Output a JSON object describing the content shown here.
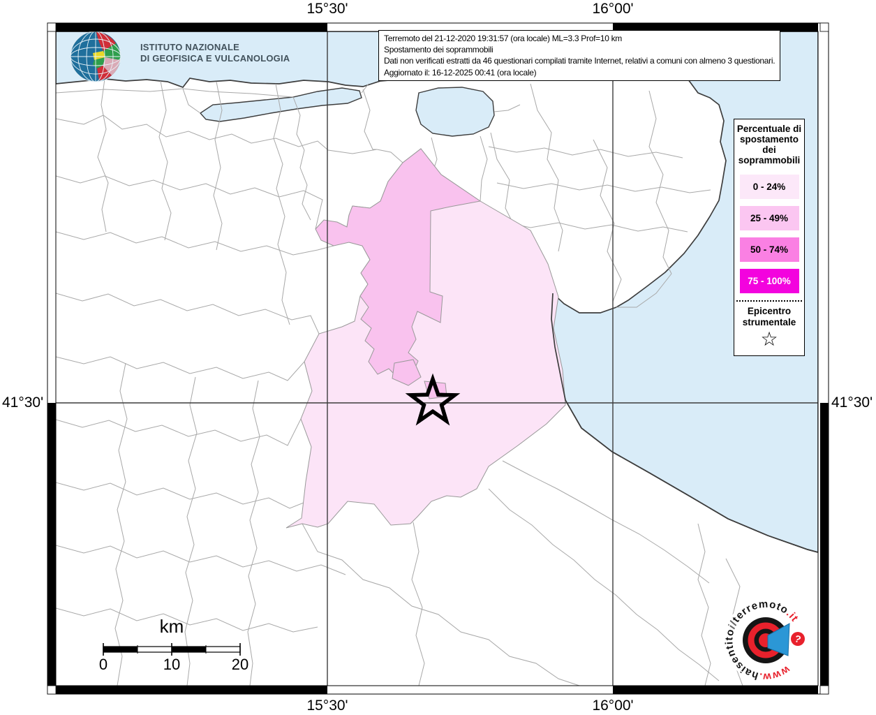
{
  "info_box": {
    "line1": "Terremoto del 21-12-2020 19:31:57 (ora locale) ML=3.3 Prof=10 km",
    "line2": "Spostamento dei soprammobili",
    "line3": "Dati non verificati estratti da 46 questionari compilati tramite Internet, relativi a comuni con almeno 3 questionari.",
    "line4": "Aggiornato il: 16-12-2025 00:41 (ora locale)"
  },
  "ingv_logo": {
    "line1": "ISTITUTO NAZIONALE",
    "line2": "DI GEOFISICA E VULCANOLOGIA"
  },
  "coordinates": {
    "top": [
      "15°30'",
      "16°00'"
    ],
    "bottom": [
      "15°30'",
      "16°00'"
    ],
    "left": "41°30'",
    "right": "41°30'"
  },
  "legend": {
    "title": "Percentuale di spostamento dei soprammobili",
    "classes": [
      {
        "label": "0 - 24%",
        "color": "#fce8f9",
        "text_color": "#000000"
      },
      {
        "label": "25 - 49%",
        "color": "#fbc6f1",
        "text_color": "#000000"
      },
      {
        "label": "50 - 74%",
        "color": "#fa80e3",
        "text_color": "#000000"
      },
      {
        "label": "75 - 100%",
        "color": "#f303de",
        "text_color": "#ffffff"
      }
    ],
    "epicenter_label": "Epicentro strumentale",
    "epicenter_symbol": "☆"
  },
  "scale_bar": {
    "unit": "km",
    "ticks": [
      "0",
      "10",
      "20"
    ]
  },
  "branding": {
    "prefix": "www.",
    "part1": "haisentito",
    "part2": "il",
    "part3": "terremoto",
    "suffix": ".it",
    "question_mark": "?"
  },
  "map": {
    "colors": {
      "sea": "#d9ecf8",
      "land": "#ffffff",
      "intensity_0_24": "#fce4f7",
      "intensity_25_49": "#f9c2ee",
      "border": "#a8a8a8",
      "coast": "#3d3d3d"
    }
  }
}
